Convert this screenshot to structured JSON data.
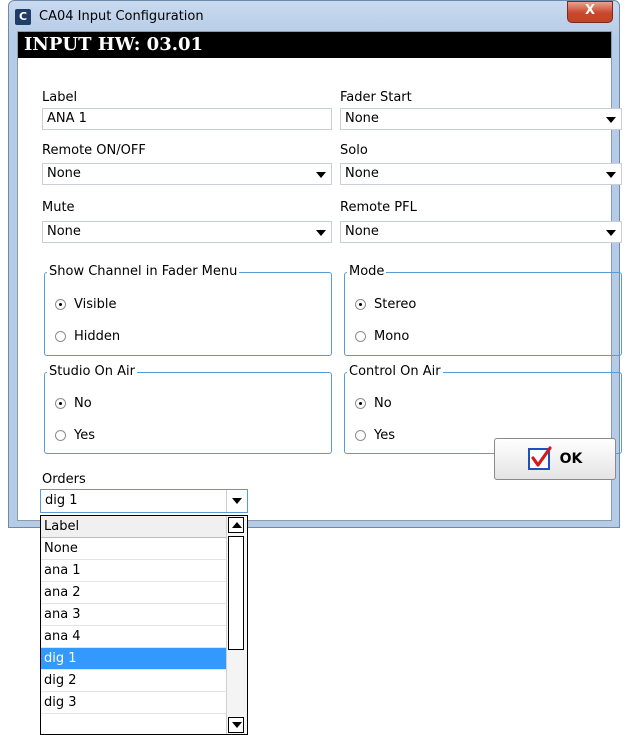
{
  "window": {
    "title": "CA04 Input Configuration",
    "icon_letter": "C",
    "close_label": "X"
  },
  "header": {
    "title": "INPUT HW: 03.01"
  },
  "fields": {
    "label": {
      "label": "Label",
      "value": "ANA 1"
    },
    "remote_on_off": {
      "label": "Remote ON/OFF",
      "value": "None"
    },
    "mute": {
      "label": "Mute",
      "value": "None"
    },
    "fader_start": {
      "label": "Fader Start",
      "value": "None"
    },
    "solo": {
      "label": "Solo",
      "value": "None"
    },
    "remote_pfl": {
      "label": "Remote PFL",
      "value": "None"
    }
  },
  "groups": {
    "show_channel": {
      "legend": "Show Channel in Fader Menu",
      "options": [
        "Visible",
        "Hidden"
      ],
      "selected": "Visible"
    },
    "mode": {
      "legend": "Mode",
      "options": [
        "Stereo",
        "Mono"
      ],
      "selected": "Stereo"
    },
    "studio_on_air": {
      "legend": "Studio On Air",
      "options": [
        "No",
        "Yes"
      ],
      "selected": "No"
    },
    "control_on_air": {
      "legend": "Control On Air",
      "options": [
        "No",
        "Yes"
      ],
      "selected": "No"
    }
  },
  "orders": {
    "label": "Orders",
    "value": "dig 1",
    "list": [
      "Label",
      "None",
      "ana 1",
      "ana 2",
      "ana 3",
      "ana 4",
      "dig 1",
      "dig 2",
      "dig 3"
    ],
    "selected": "dig 1"
  },
  "ok_button": {
    "label": "OK"
  }
}
